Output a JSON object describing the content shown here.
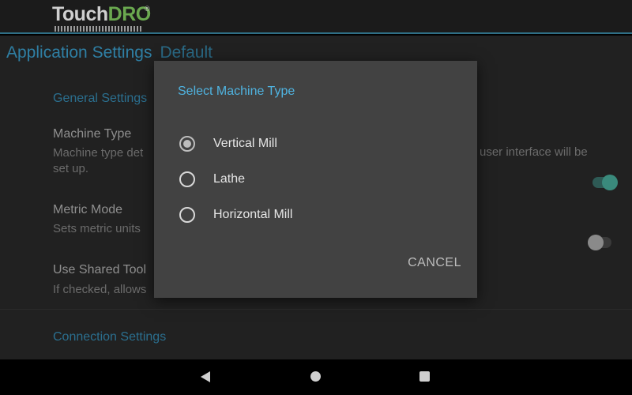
{
  "app": {
    "logo_part1": "Touch",
    "logo_part2": "DRO",
    "logo_reg": "®"
  },
  "settings": {
    "title": "Application Settings",
    "profile": "Default",
    "general_category": "General Settings",
    "machine_type": {
      "title": "Machine Type",
      "summary_left": "Machine type det",
      "summary_right": "user interface will be",
      "summary_line2": "set up."
    },
    "metric_mode": {
      "title": "Metric Mode",
      "summary": "Sets metric units",
      "enabled": true
    },
    "shared_tool": {
      "title": "Use Shared Tool",
      "summary": "If checked, allows",
      "enabled": false
    },
    "connection_category": "Connection Settings"
  },
  "dialog": {
    "title": "Select Machine Type",
    "options": [
      {
        "label": "Vertical Mill",
        "checked": true
      },
      {
        "label": "Lathe",
        "checked": false
      },
      {
        "label": "Horizontal Mill",
        "checked": false
      }
    ],
    "cancel_label": "CANCEL"
  },
  "colors": {
    "accent": "#4fb3e0",
    "logo_green": "#6aa84f",
    "dialog_bg": "#424242"
  }
}
